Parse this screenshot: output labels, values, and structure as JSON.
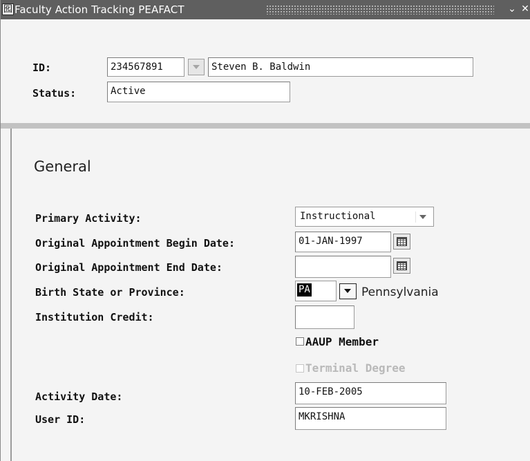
{
  "window": {
    "title": "Faculty Action Tracking  PEAFACT",
    "app_icon_glyph": "囮",
    "minimize_glyph": "⌄",
    "close_glyph": "✕"
  },
  "key_block": {
    "id_label": "ID:",
    "id_value": "234567891",
    "name_value": "Steven B. Baldwin",
    "status_label": "Status:",
    "status_value": "Active"
  },
  "general": {
    "section_title": "General",
    "primary_activity_label": "Primary Activity:",
    "primary_activity_value": "Instructional",
    "orig_begin_label": "Original Appointment Begin Date:",
    "orig_begin_value": "01-JAN-1997",
    "orig_end_label": "Original Appointment End Date:",
    "orig_end_value": "",
    "birth_state_label": "Birth State or Province:",
    "birth_state_code": "PA",
    "birth_state_desc": "Pennsylvania",
    "institution_credit_label": "Institution Credit:",
    "institution_credit_value": "",
    "aaup_label": "AAUP Member",
    "aaup_checked": false,
    "terminal_degree_label": "Terminal Degree",
    "terminal_degree_checked": false,
    "terminal_degree_enabled": false,
    "activity_date_label": "Activity Date:",
    "activity_date_value": "10-FEB-2005",
    "user_id_label": "User ID:",
    "user_id_value": "MKRISHNA"
  }
}
